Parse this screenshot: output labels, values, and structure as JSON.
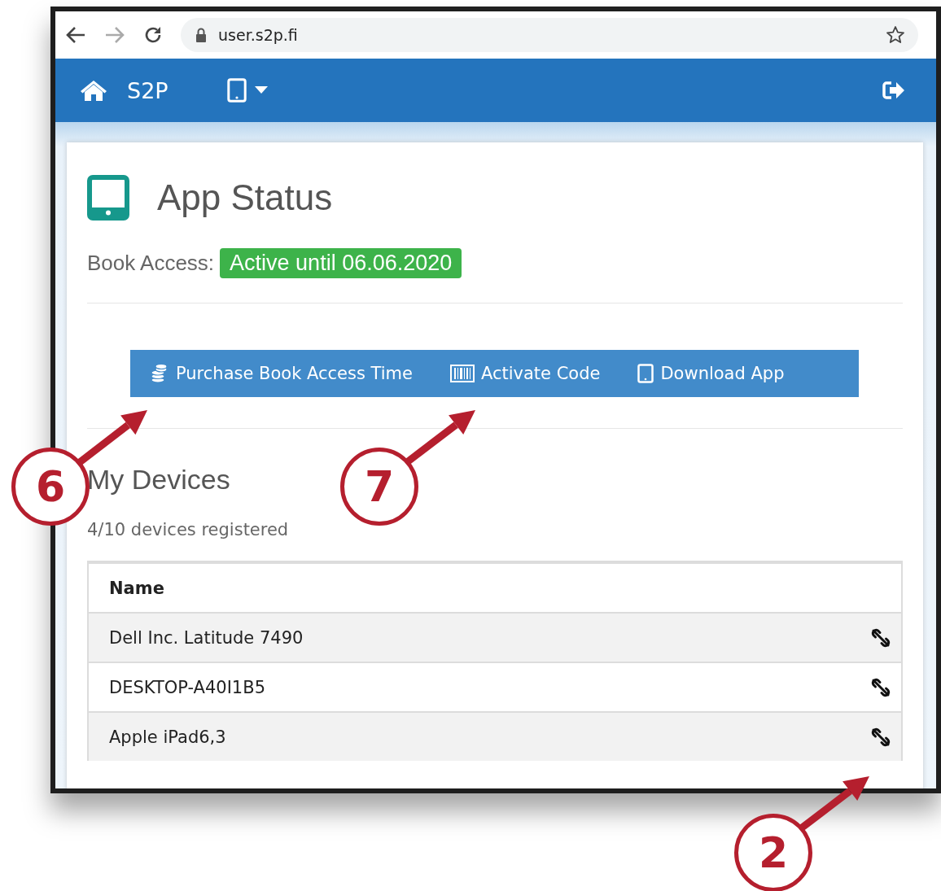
{
  "browser": {
    "url": "user.s2p.fi"
  },
  "navbar": {
    "brand": "S2P"
  },
  "page": {
    "title": "App Status",
    "access_label": "Book Access:",
    "access_badge": "Active until 06.06.2020",
    "actions": [
      {
        "kind": "coins",
        "label": "Purchase Book Access Time"
      },
      {
        "kind": "barcode",
        "label": "Activate Code"
      },
      {
        "kind": "tablet",
        "label": "Download App"
      }
    ],
    "devices_title": "My Devices",
    "devices_count": "4/10 devices registered",
    "table": {
      "columns": [
        "Name"
      ],
      "rows": [
        {
          "name": "Dell Inc. Latitude 7490"
        },
        {
          "name": "DESKTOP-A40I1B5"
        },
        {
          "name": "Apple iPad6,3"
        }
      ]
    }
  },
  "callouts": [
    {
      "number": "6"
    },
    {
      "number": "7"
    },
    {
      "number": "2"
    }
  ]
}
